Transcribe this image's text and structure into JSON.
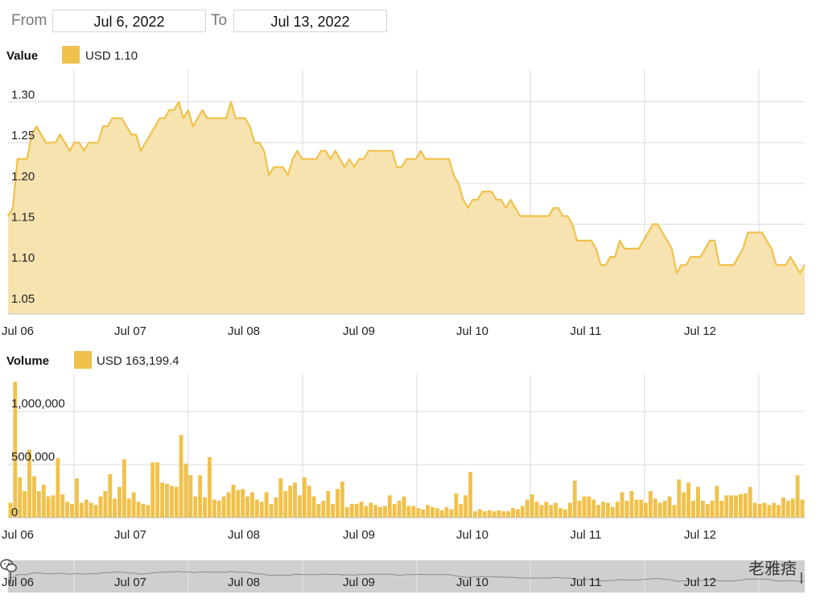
{
  "range": {
    "from_label": "From",
    "from_value": "Jul 6, 2022",
    "to_label": "To",
    "to_value": "Jul 13, 2022"
  },
  "value_legend": {
    "title": "Value",
    "entry": "USD 1.10"
  },
  "volume_legend": {
    "title": "Volume",
    "entry": "USD 163,199.4"
  },
  "navigator": {
    "handle_left": "|",
    "handle_right": "|"
  },
  "watermark": {
    "text": "老雅痞"
  },
  "colors": {
    "accent": "#f0c14b",
    "fill": "#f7e3b0",
    "grid": "#dddddd",
    "navigator": "#cfcfcf"
  },
  "chart_data": [
    {
      "type": "area",
      "title": "Value",
      "legend": "USD 1.10",
      "x_ticks": [
        "Jul 06",
        "Jul 07",
        "Jul 08",
        "Jul 09",
        "Jul 10",
        "Jul 11",
        "Jul 12"
      ],
      "x_domain": [
        "2022-07-06T00:00",
        "2022-07-12T23:30"
      ],
      "ylim": [
        1.04,
        1.34
      ],
      "y_ticks": [
        "1.05",
        "1.10",
        "1.15",
        "1.20",
        "1.25",
        "1.30"
      ],
      "grid": true,
      "series": [
        {
          "values": [
            1.16,
            1.17,
            1.23,
            1.23,
            1.23,
            1.26,
            1.27,
            1.26,
            1.25,
            1.25,
            1.25,
            1.26,
            1.25,
            1.24,
            1.25,
            1.25,
            1.24,
            1.25,
            1.25,
            1.25,
            1.27,
            1.27,
            1.28,
            1.28,
            1.28,
            1.27,
            1.26,
            1.26,
            1.24,
            1.25,
            1.26,
            1.27,
            1.28,
            1.28,
            1.29,
            1.29,
            1.3,
            1.28,
            1.29,
            1.27,
            1.28,
            1.29,
            1.28,
            1.28,
            1.28,
            1.28,
            1.28,
            1.3,
            1.28,
            1.28,
            1.28,
            1.27,
            1.25,
            1.25,
            1.24,
            1.21,
            1.22,
            1.22,
            1.22,
            1.21,
            1.23,
            1.24,
            1.23,
            1.23,
            1.23,
            1.23,
            1.24,
            1.24,
            1.23,
            1.24,
            1.23,
            1.22,
            1.23,
            1.22,
            1.23,
            1.23,
            1.24,
            1.24,
            1.24,
            1.24,
            1.24,
            1.24,
            1.22,
            1.22,
            1.23,
            1.23,
            1.23,
            1.24,
            1.23,
            1.23,
            1.23,
            1.23,
            1.23,
            1.23,
            1.21,
            1.2,
            1.18,
            1.17,
            1.18,
            1.18,
            1.19,
            1.19,
            1.19,
            1.18,
            1.18,
            1.17,
            1.18,
            1.17,
            1.16,
            1.16,
            1.16,
            1.16,
            1.16,
            1.16,
            1.16,
            1.17,
            1.17,
            1.16,
            1.16,
            1.15,
            1.13,
            1.13,
            1.13,
            1.13,
            1.12,
            1.1,
            1.1,
            1.11,
            1.11,
            1.13,
            1.12,
            1.12,
            1.12,
            1.12,
            1.13,
            1.14,
            1.15,
            1.15,
            1.14,
            1.13,
            1.12,
            1.09,
            1.1,
            1.1,
            1.11,
            1.11,
            1.11,
            1.12,
            1.13,
            1.13,
            1.1,
            1.1,
            1.1,
            1.1,
            1.11,
            1.12,
            1.14,
            1.14,
            1.14,
            1.14,
            1.13,
            1.12,
            1.1,
            1.1,
            1.1,
            1.11,
            1.1,
            1.09,
            1.1
          ]
        }
      ]
    },
    {
      "type": "bar",
      "title": "Volume",
      "legend": "USD 163,199.4",
      "x_ticks": [
        "Jul 06",
        "Jul 07",
        "Jul 08",
        "Jul 09",
        "Jul 10",
        "Jul 11",
        "Jul 12"
      ],
      "x_domain": [
        "2022-07-06T00:00",
        "2022-07-12T23:30"
      ],
      "ylim": [
        0,
        1350000
      ],
      "y_ticks": [
        "0",
        "500,000",
        "1,000,000"
      ],
      "grid": true,
      "series": [
        {
          "values": [
            140000,
            1280000,
            380000,
            250000,
            640000,
            390000,
            250000,
            310000,
            200000,
            210000,
            560000,
            220000,
            150000,
            130000,
            370000,
            140000,
            170000,
            140000,
            120000,
            200000,
            250000,
            410000,
            180000,
            290000,
            550000,
            180000,
            240000,
            150000,
            130000,
            120000,
            520000,
            520000,
            330000,
            320000,
            300000,
            290000,
            780000,
            510000,
            400000,
            200000,
            400000,
            190000,
            570000,
            170000,
            160000,
            200000,
            240000,
            310000,
            260000,
            270000,
            200000,
            240000,
            170000,
            150000,
            240000,
            130000,
            190000,
            370000,
            250000,
            300000,
            330000,
            210000,
            380000,
            300000,
            200000,
            130000,
            160000,
            250000,
            130000,
            270000,
            340000,
            100000,
            130000,
            130000,
            150000,
            110000,
            140000,
            120000,
            100000,
            110000,
            210000,
            130000,
            160000,
            200000,
            110000,
            110000,
            90000,
            80000,
            120000,
            100000,
            90000,
            70000,
            100000,
            80000,
            230000,
            130000,
            210000,
            430000,
            60000,
            80000,
            60000,
            70000,
            60000,
            70000,
            60000,
            60000,
            90000,
            80000,
            110000,
            170000,
            220000,
            150000,
            120000,
            150000,
            120000,
            140000,
            90000,
            80000,
            140000,
            350000,
            160000,
            200000,
            200000,
            170000,
            120000,
            150000,
            140000,
            100000,
            150000,
            240000,
            160000,
            250000,
            170000,
            170000,
            140000,
            250000,
            180000,
            140000,
            160000,
            200000,
            120000,
            360000,
            240000,
            330000,
            160000,
            290000,
            160000,
            130000,
            160000,
            300000,
            160000,
            210000,
            210000,
            210000,
            220000,
            230000,
            290000,
            140000,
            130000,
            140000,
            120000,
            140000,
            120000,
            190000,
            160000,
            180000,
            400000,
            170000
          ]
        }
      ]
    }
  ]
}
